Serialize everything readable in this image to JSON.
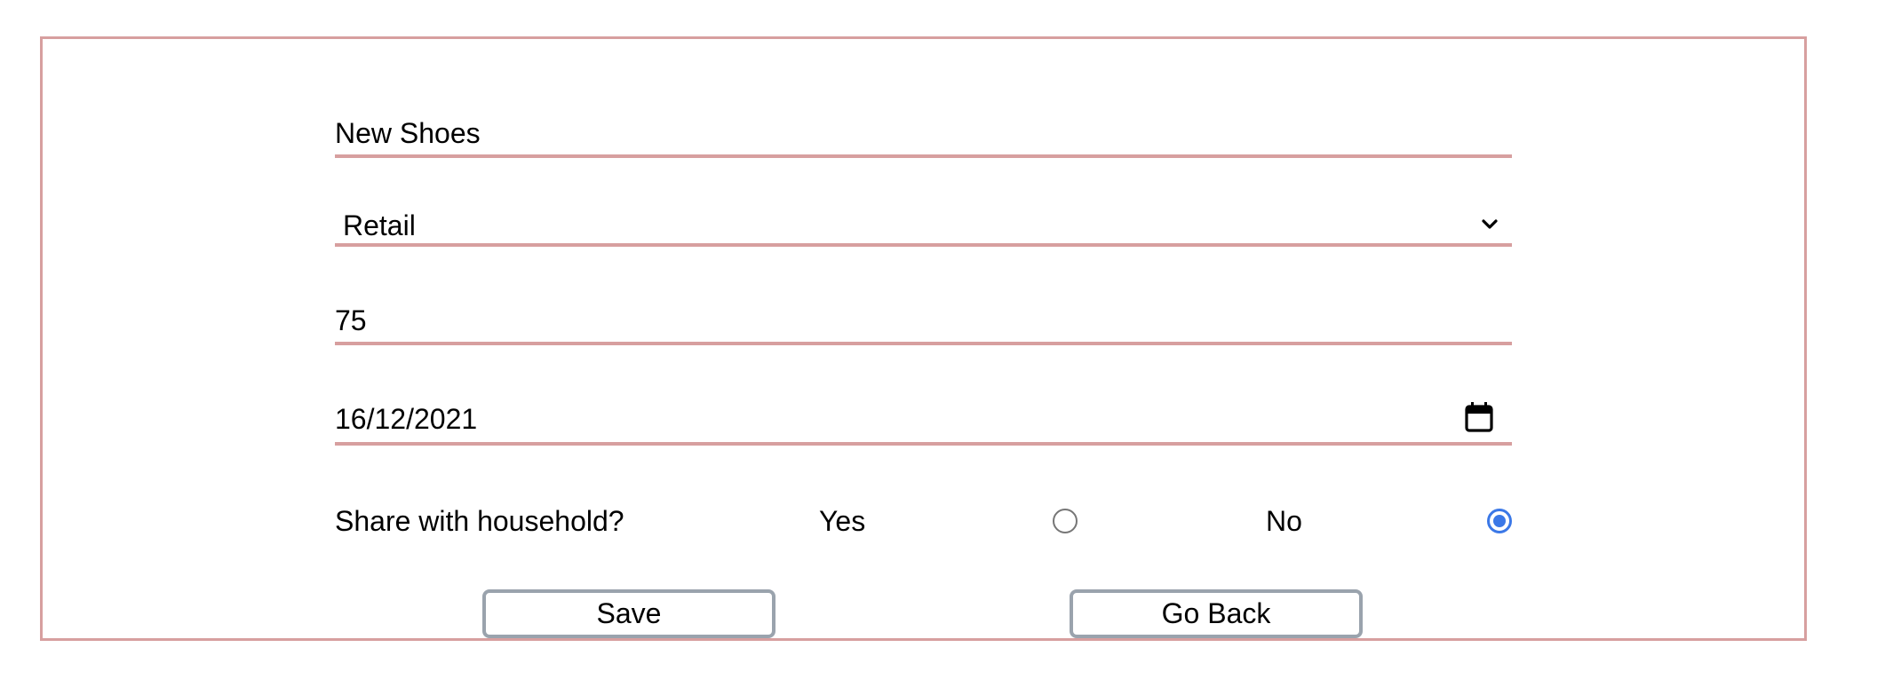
{
  "form": {
    "name_value": "New Shoes",
    "category_value": "Retail",
    "amount_value": "75",
    "date_value": "16/12/2021",
    "share": {
      "question": "Share with household?",
      "yes_label": "Yes",
      "no_label": "No",
      "selected": "No"
    },
    "buttons": {
      "save_label": "Save",
      "back_label": "Go Back"
    }
  },
  "icons": {
    "dropdown": "chevron-down-icon",
    "date_picker": "calendar-icon"
  },
  "colors": {
    "frame_border": "#d79f9f",
    "field_underline": "#d79f9f",
    "radio_selected": "#3b78e7",
    "button_border": "#9aa3ad"
  }
}
